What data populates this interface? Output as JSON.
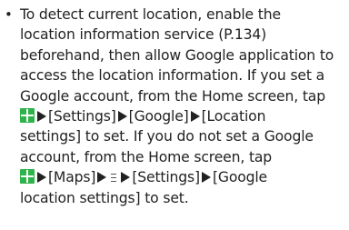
{
  "note": {
    "bullet": "•",
    "line1": "To detect current location, enable the",
    "line2": "location information service (P.134)",
    "line3": "beforehand, then allow Google application to",
    "line4": "access the location information. If you set a",
    "line5": "Google account, from the Home screen, tap",
    "line6_a": "[Settings]",
    "line6_b": "[Google]",
    "line6_c": "[Location",
    "line7": "settings] to set. If you do not set a Google",
    "line8": "account, from the Home screen, tap",
    "line9_a": "[Maps]",
    "line9_b": "[Settings]",
    "line9_c": "[Google",
    "line10": "location settings] to set."
  },
  "icons": {
    "apps": "apps-icon",
    "arrow": "arrow-icon",
    "menu": "menu-icon",
    "apps_color": "#2db34a"
  }
}
